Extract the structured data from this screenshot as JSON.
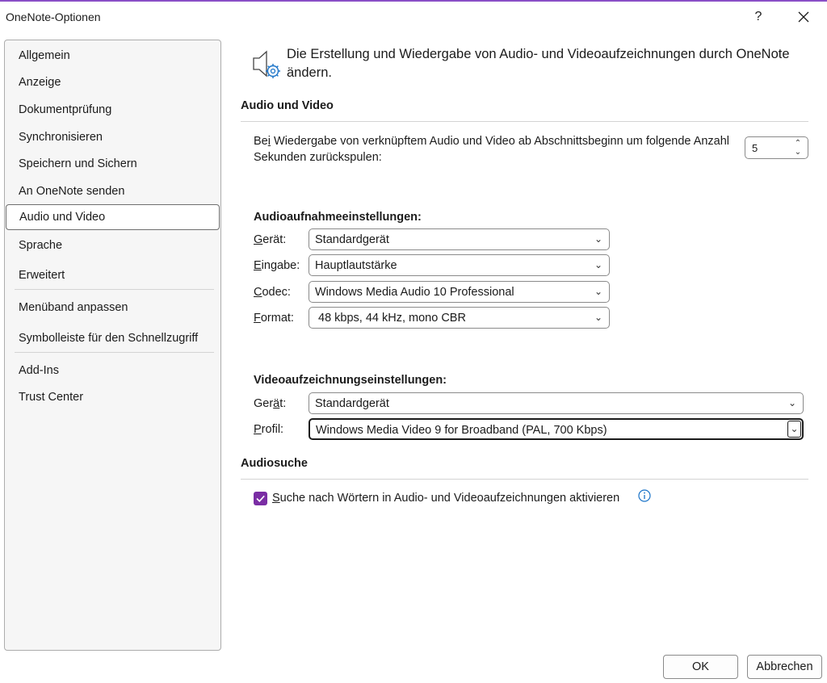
{
  "window": {
    "title": "OneNote-Optionen",
    "help_label": "?",
    "close_label": "✕"
  },
  "sidebar": {
    "items": [
      {
        "label": "Allgemein"
      },
      {
        "label": "Anzeige"
      },
      {
        "label": "Dokumentprüfung"
      },
      {
        "label": "Synchronisieren"
      },
      {
        "label": "Speichern und Sichern"
      },
      {
        "label": "An OneNote senden"
      },
      {
        "label": "Audio und Video",
        "selected": true
      },
      {
        "label": "Sprache"
      },
      {
        "label": "Erweitert"
      },
      {
        "label": "Menüband anpassen"
      },
      {
        "label": "Symbolleiste für den Schnellzugriff"
      },
      {
        "label": "Add-Ins"
      },
      {
        "label": "Trust Center"
      }
    ]
  },
  "header": {
    "icon": "speaker-gear-icon",
    "text": "Die Erstellung und Wiedergabe von Audio- und Videoaufzeichnungen durch OneNote ändern."
  },
  "audio_video": {
    "title": "Audio und Video",
    "rewind_text_pre": "Be",
    "rewind_text_u": "i",
    "rewind_text_post": " Wiedergabe von verknüpftem Audio und Video ab Abschnittsbeginn um folgende Anzahl Sekunden zurückspulen:",
    "rewind_value": "5"
  },
  "audio_settings": {
    "title": "Audioaufnahmeeinstellungen:",
    "device_label_u": "G",
    "device_label_rest": "erät:",
    "device_value": "Standardgerät",
    "input_label_u": "E",
    "input_label_rest": "ingabe:",
    "input_value": "Hauptlautstärke",
    "codec_label_u": "C",
    "codec_label_rest": "odec:",
    "codec_value": "Windows Media Audio 10 Professional",
    "format_label_u": "F",
    "format_label_rest": "ormat:",
    "format_value": "48 kbps, 44 kHz, mono CBR"
  },
  "video_settings": {
    "title": "Videoaufzeichnungseinstellungen:",
    "device_label_pre": "Ger",
    "device_label_u": "ä",
    "device_label_rest": "t:",
    "device_value": "Standardgerät",
    "profile_label_u": "P",
    "profile_label_rest": "rofil:",
    "profile_value": "Windows Media Video 9 for Broadband (PAL, 700 Kbps)"
  },
  "audio_search": {
    "title": "Audiosuche",
    "checkbox_label_u": "S",
    "checkbox_label_rest": "uche nach Wörtern in Audio- und Videoaufzeichnungen aktivieren",
    "checked": true,
    "info_icon": "info-icon"
  },
  "footer": {
    "ok_label": "OK",
    "cancel_label": "Abbrechen"
  },
  "colors": {
    "accent": "#7a2da4",
    "info": "#1a73c8",
    "border": "#8a8a8a"
  }
}
